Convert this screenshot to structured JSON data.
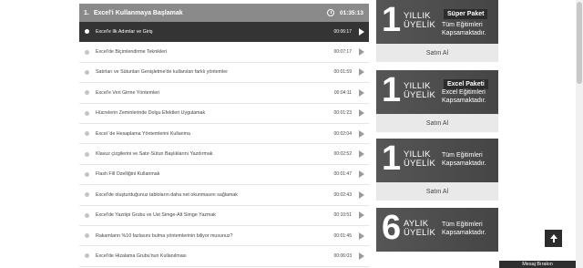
{
  "section": {
    "number": "1.",
    "title": "Excel'i Kullanmaya Başlamak",
    "duration": "01:35:13"
  },
  "lessons": [
    {
      "title": "Excel'e İlk Adımlar ve Giriş",
      "duration": "00:06:17",
      "active": true
    },
    {
      "title": "Excel'de Biçimlendirme Teknikleri",
      "duration": "00:07:17"
    },
    {
      "title": "Satırları ve Sütunları Genişletme'de kullanılan farklı yöntemler",
      "duration": "00:01:59"
    },
    {
      "title": "Excel'e Veri Girme Yöntemleri",
      "duration": "00:04:11"
    },
    {
      "title": "Hücrelerin Zeminlerinde Dolgu Efektleri Uygulamak",
      "duration": "00:01:23"
    },
    {
      "title": "Excel 'de Hesaplama Yöntemlerini Kullanma",
      "duration": "00:02:04"
    },
    {
      "title": "Klavuz çizgilerini ve Satır-Sütun Başlıklarını Yazdırmak",
      "duration": "00:02:52"
    },
    {
      "title": "Flash Fill Özelliğini Kullanmak",
      "duration": "00:01:47"
    },
    {
      "title": "Excel'de oluşturduğunuz tabloların daha net okunmasını sağlamak",
      "duration": "00:02:43"
    },
    {
      "title": "Excel'de Yazıtipi Grubu ve Üst Simge-Alt Simge Yazmak",
      "duration": "00:10:51"
    },
    {
      "title": "Rakamların %10 fazlasını bulma yöntemlerinin biliyor musunuz?",
      "duration": "00:01:45"
    },
    {
      "title": "Excel'de Hizalama Grubu'nun Kullanılması",
      "duration": "00:06:03"
    }
  ],
  "cards": [
    {
      "number": "1",
      "period_line1": "YILLIK",
      "period_line2": "ÜYELİK",
      "package": "Süper Paket",
      "desc_line1": "Tüm Eğitimleri",
      "desc_line2": "Kapsamaktadır.",
      "buy": "Satın Al"
    },
    {
      "number": "1",
      "period_line1": "YILLIK",
      "period_line2": "ÜYELİK",
      "package": "Excel Paketi",
      "desc_line1": "Excel Eğitimleri",
      "desc_line2": "Kapsamaktadır.",
      "buy": "Satın Al"
    },
    {
      "number": "1",
      "period_line1": "YILLIK",
      "period_line2": "ÜYELİK",
      "package": "",
      "desc_line1": "Tüm Eğitimleri",
      "desc_line2": "Kapsamaktadır.",
      "buy": "Satın Al"
    },
    {
      "number": "6",
      "period_line1": "AYLIK",
      "period_line2": "ÜYELİK",
      "package": "",
      "desc_line1": "Tüm Eğitimleri",
      "desc_line2": "Kapsamaktadır.",
      "buy": ""
    }
  ],
  "message_tab": "Mesaj Bırakın"
}
